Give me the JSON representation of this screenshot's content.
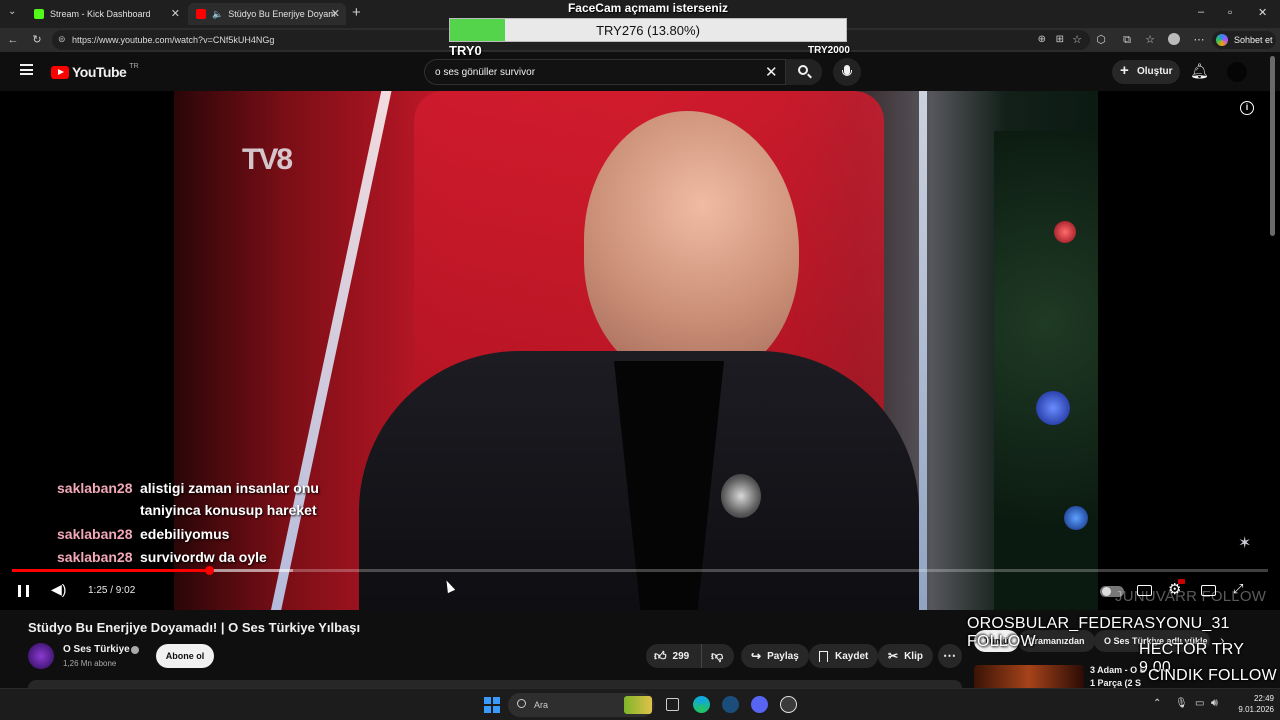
{
  "browser": {
    "tabs": [
      {
        "label": "Stream - Kick Dashboard",
        "favicon_color": "#53fc18"
      },
      {
        "label": "Stüdyo Bu Enerjiye Doyamadı",
        "favicon_color": "#ff0000"
      }
    ],
    "url": "https://www.youtube.com/watch?v=CNf5kUH4NGg",
    "sidebar_chat_label": "Sohbet et",
    "new_tab": "+",
    "window_controls": [
      "–",
      "▫",
      "✕"
    ]
  },
  "goal_overlay": {
    "title": "FaceCam açmamı isterseniz",
    "progress_text": "TRY276 (13.80%)",
    "progress_fraction": 0.138,
    "min_label": "TRY0",
    "max_label": "TRY2000",
    "fill_color": "#53d44b"
  },
  "youtube": {
    "logo_text": "YouTube",
    "logo_region": "TR",
    "search_query": "o ses gönüller survivor",
    "create_label": "Oluştur",
    "brand_color": "#ff0000"
  },
  "video": {
    "channel_watermark": "TV8",
    "time_display": "1:25 / 9:02",
    "played_fraction": 0.157,
    "buffered_fraction": 0.224,
    "chat": [
      {
        "user": "saklaban28",
        "lines": [
          "alistigi zaman insanlar onu",
          "taniyinca konusup hareket"
        ]
      },
      {
        "user": "saklaban28",
        "lines": [
          "edebiliyomus"
        ]
      },
      {
        "user": "saklaban28",
        "lines": [
          "survivordw da oyle"
        ]
      }
    ]
  },
  "meta": {
    "title": "Stüdyo Bu Enerjiye Doyamadı! | O Ses Türkiye Yılbaşı",
    "channel": "O Ses Türkiye",
    "subscribers": "1,26 Mn abone",
    "subscribe_label": "Abone ol",
    "likes": "299",
    "share_label": "Paylaş",
    "save_label": "Kaydet",
    "clip_label": "Klip",
    "more": "⋯"
  },
  "related": {
    "chips": [
      "Tümü",
      "Aramanızdan",
      "O Ses Türkiye adlı yükle"
    ],
    "first_title_partial": "3 Adam - O S",
    "first_sub_partial": "1 Parça (2 S"
  },
  "alerts": {
    "items": [
      "OROSBULAR_FEDERASYONU_31 FOLLOW",
      "HECTOR  TRY 9.00",
      "CINDIK  FOLLOW"
    ],
    "faded": "JUNUVARR FOLLOW"
  },
  "taskbar": {
    "search_placeholder": "Ara",
    "time": "22:49",
    "date": "9.01.2026"
  }
}
